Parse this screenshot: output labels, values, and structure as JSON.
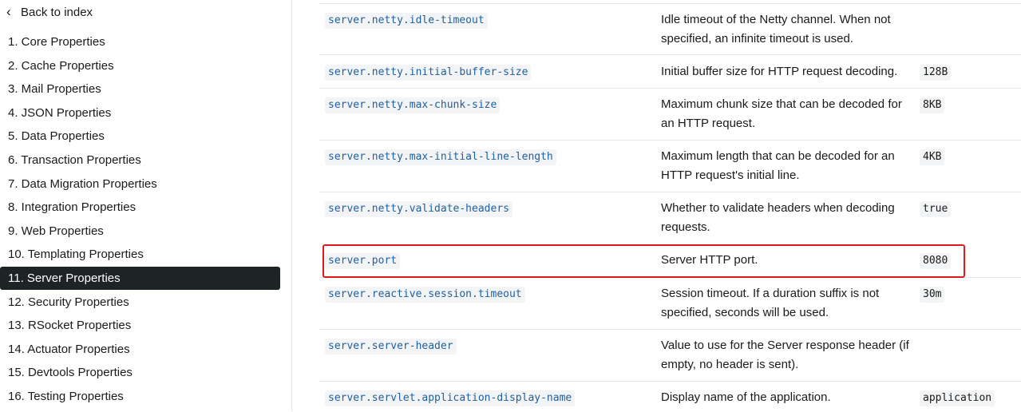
{
  "sidebar": {
    "back_label": "Back to index",
    "items": [
      {
        "label": "1. Core Properties"
      },
      {
        "label": "2. Cache Properties"
      },
      {
        "label": "3. Mail Properties"
      },
      {
        "label": "4. JSON Properties"
      },
      {
        "label": "5. Data Properties"
      },
      {
        "label": "6. Transaction Properties"
      },
      {
        "label": "7. Data Migration Properties"
      },
      {
        "label": "8. Integration Properties"
      },
      {
        "label": "9. Web Properties"
      },
      {
        "label": "10. Templating Properties"
      },
      {
        "label": "11. Server Properties",
        "active": true
      },
      {
        "label": "12. Security Properties"
      },
      {
        "label": "13. RSocket Properties"
      },
      {
        "label": "14. Actuator Properties"
      },
      {
        "label": "15. Devtools Properties"
      },
      {
        "label": "16. Testing Properties"
      }
    ]
  },
  "properties": [
    {
      "name": "server.netty.idle-timeout",
      "desc": "Idle timeout of the Netty channel. When not specified, an infinite timeout is used.",
      "default": ""
    },
    {
      "name": "server.netty.initial-buffer-size",
      "desc": "Initial buffer size for HTTP request decoding.",
      "default": "128B"
    },
    {
      "name": "server.netty.max-chunk-size",
      "desc": "Maximum chunk size that can be decoded for an HTTP request.",
      "default": "8KB"
    },
    {
      "name": "server.netty.max-initial-line-length",
      "desc": "Maximum length that can be decoded for an HTTP request's initial line.",
      "default": "4KB"
    },
    {
      "name": "server.netty.validate-headers",
      "desc": "Whether to validate headers when decoding requests.",
      "default": "true"
    },
    {
      "name": "server.port",
      "desc": "Server HTTP port.",
      "default": "8080",
      "highlighted": true
    },
    {
      "name": "server.reactive.session.timeout",
      "desc": "Session timeout. If a duration suffix is not specified, seconds will be used.",
      "default": "30m"
    },
    {
      "name": "server.server-header",
      "desc": "Value to use for the Server response header (if empty, no header is sent).",
      "default": ""
    },
    {
      "name": "server.servlet.application-display-name",
      "desc": "Display name of the application.",
      "default": "application"
    }
  ],
  "colors": {
    "active_bg": "#1e2326",
    "highlight_border": "#e0191b",
    "key_text": "#1f5f9e"
  }
}
